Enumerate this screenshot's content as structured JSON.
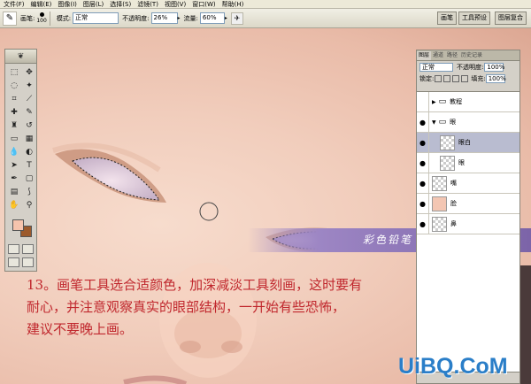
{
  "menu": [
    "文件(F)",
    "编辑(E)",
    "图像(I)",
    "图层(L)",
    "选择(S)",
    "滤镜(T)",
    "视图(V)",
    "窗口(W)",
    "帮助(H)"
  ],
  "options": {
    "brush_label": "画笔:",
    "brush_size": "100",
    "mode_label": "模式:",
    "mode_value": "正常",
    "opacity_label": "不透明度:",
    "opacity_value": "26%",
    "flow_label": "流量:",
    "flow_value": "60%",
    "well_buttons": [
      "画笔",
      "工具预设",
      "图层复合"
    ]
  },
  "colors": {
    "foreground": "#f6c4ad",
    "background": "#9c5a2c",
    "accent_red": "#c0272d",
    "banner_purple": "#7c64a8"
  },
  "layers_panel": {
    "tabs": [
      "图层",
      "通道",
      "路径",
      "历史记录"
    ],
    "blend_mode": "正常",
    "opacity_label": "不透明度:",
    "opacity_value": "100%",
    "lock_label": "锁定:",
    "fill_label": "填充:",
    "fill_value": "100%",
    "layers": [
      {
        "name": "教程",
        "type": "group",
        "expanded": false,
        "visible": false
      },
      {
        "name": "眼",
        "type": "group",
        "expanded": true,
        "visible": true
      },
      {
        "name": "眼白",
        "type": "layer",
        "selected": true,
        "visible": true,
        "thumb": "transparent"
      },
      {
        "name": "眼",
        "type": "layer",
        "visible": true,
        "thumb": "transparent"
      },
      {
        "name": "嘴",
        "type": "layer",
        "visible": true,
        "thumb": "transparent"
      },
      {
        "name": "脸",
        "type": "layer",
        "visible": true,
        "thumb": "fill"
      },
      {
        "name": "鼻",
        "type": "layer",
        "visible": true,
        "thumb": "transparent"
      }
    ]
  },
  "banner_text": "彩色铅笔 情 原创教程",
  "caption": [
    "13。画笔工具选合适颜色，加深减淡工具刻画，这时要有",
    "耐心，并注意观察真实的眼部结构，一开始有些恐怖，",
    "建议不要晚上画。"
  ],
  "watermark": "UiBQ.CoM"
}
